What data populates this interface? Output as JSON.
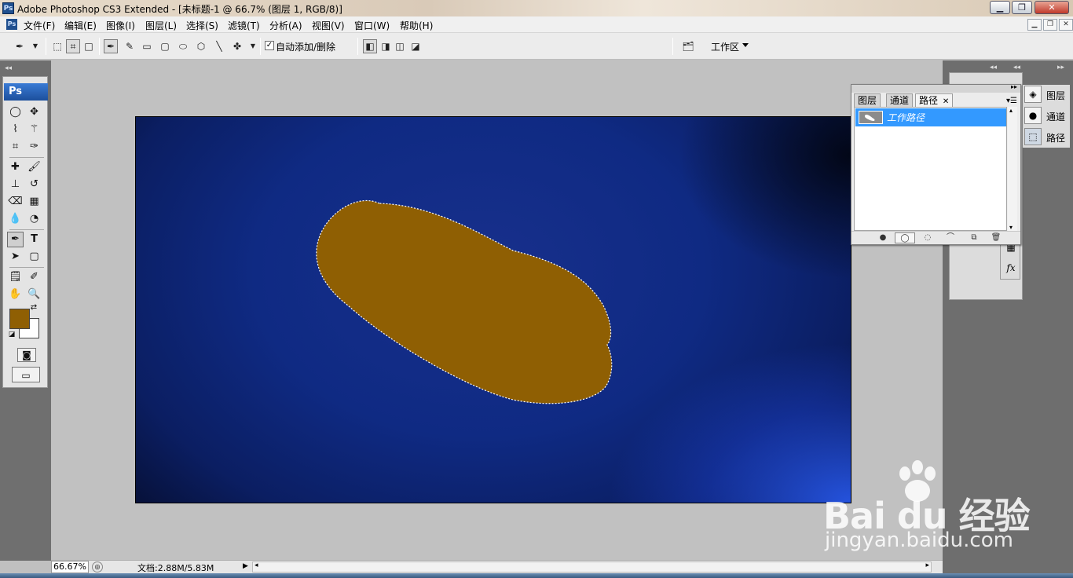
{
  "window": {
    "title": "Adobe Photoshop CS3 Extended - [未标题-1 @ 66.7% (图层 1, RGB/8)]",
    "app_icon": "Ps"
  },
  "menu": {
    "items": [
      "文件(F)",
      "编辑(E)",
      "图像(I)",
      "图层(L)",
      "选择(S)",
      "滤镜(T)",
      "分析(A)",
      "视图(V)",
      "窗口(W)",
      "帮助(H)"
    ]
  },
  "options": {
    "auto_add_delete_label": "自动添加/删除",
    "auto_add_delete_checked": true,
    "workspace_label": "工作区"
  },
  "toolbox": {
    "header": "Ps",
    "foreground_color": "#8f5f03",
    "background_color": "#ffffff"
  },
  "status": {
    "zoom": "66.67%",
    "doc_info": "文档:2.88M/5.83M"
  },
  "dock": {
    "items": [
      {
        "label": "图层",
        "icon": "layers-icon"
      },
      {
        "label": "通道",
        "icon": "channels-icon"
      },
      {
        "label": "路径",
        "icon": "paths-icon"
      }
    ]
  },
  "paths_panel": {
    "tabs": [
      "图层",
      "通道",
      "路径"
    ],
    "active_tab": "路径",
    "path_items": [
      {
        "name": "工作路径",
        "selected": true
      }
    ]
  },
  "canvas": {
    "shape_fill": "#8f5f03"
  },
  "watermark": {
    "brand": "Bai du 经验",
    "url": "jingyan.baidu.com"
  }
}
